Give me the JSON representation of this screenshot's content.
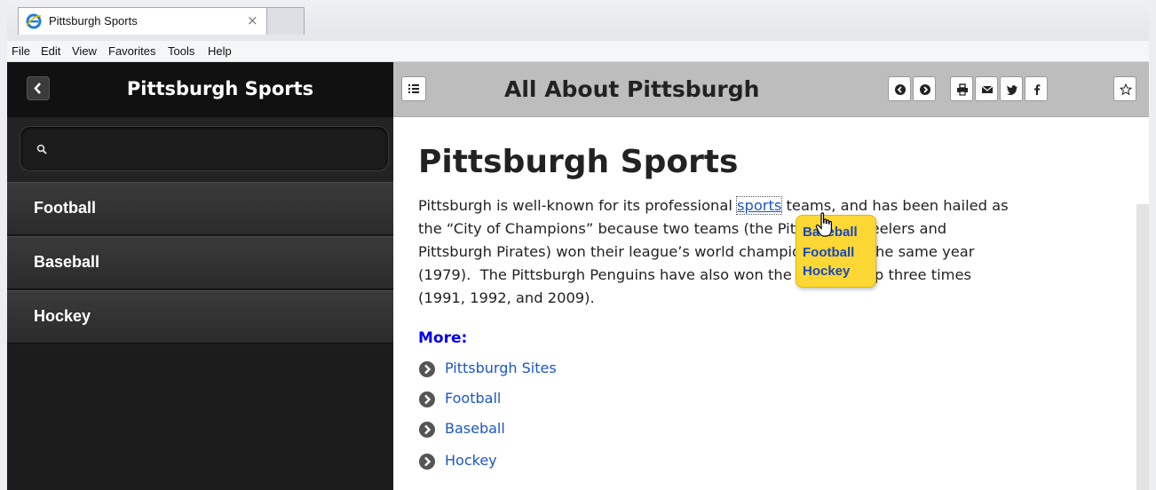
{
  "browser": {
    "tab_title": "Pittsburgh Sports",
    "tab_close": "×",
    "menu": [
      "File",
      "Edit",
      "View",
      "Favorites",
      "Tools",
      "Help"
    ]
  },
  "sidebar": {
    "title": "Pittsburgh Sports",
    "search_placeholder": "",
    "items": [
      {
        "label": "Football"
      },
      {
        "label": "Baseball"
      },
      {
        "label": "Hockey"
      }
    ]
  },
  "header": {
    "title": "All About Pittsburgh",
    "buttons": [
      "back-icon",
      "forward-icon",
      "print-icon",
      "mail-icon",
      "twitter-icon",
      "facebook-icon",
      "star-icon"
    ]
  },
  "article": {
    "title": "Pittsburgh Sports",
    "line1_before": "Pittsburgh is well-known for its professional ",
    "line1_link": "sports",
    "line1_after": " teams, and has been hailed as",
    "line2": "the “City of Champions” because two teams (the Pittsburgh Steelers and",
    "line3": "Pittsburgh Pirates) won their league’s world championships in the same year",
    "line4": "(1979).  The Pittsburgh Penguins have also won the Stanley Cup three times",
    "line5": "(1991, 1992, and 2009)."
  },
  "more": {
    "label": "More:",
    "links": [
      "Pittsburgh Sites",
      "Football",
      "Baseball",
      "Hockey"
    ]
  },
  "popup": {
    "items": [
      "Baseball",
      "Football",
      "Hockey"
    ]
  },
  "colors": {
    "link": "#1a56c8",
    "popup_bg": "#fdd835",
    "sidebar_bg": "#1c1c1c",
    "more_label": "#0000ee"
  }
}
